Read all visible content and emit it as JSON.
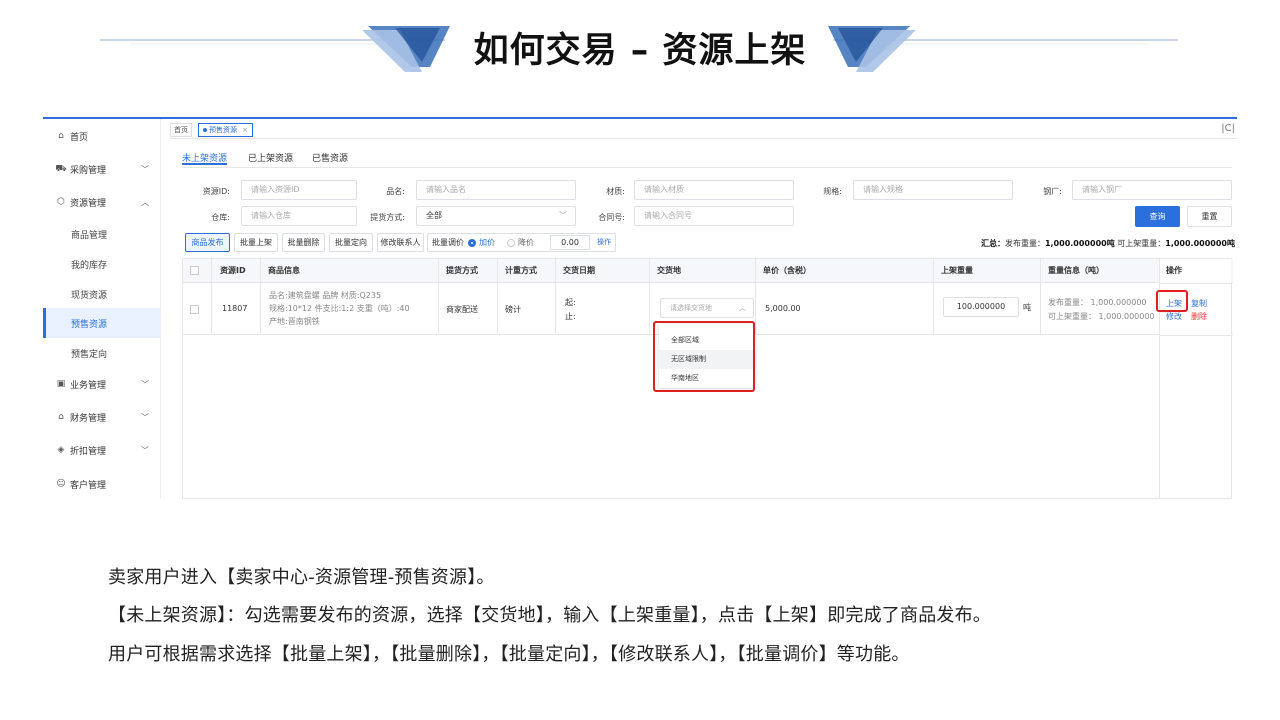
{
  "slide": {
    "title": "如何交易 – 资源上架",
    "lines": [
      "卖家用户进入【卖家中心-资源管理-预售资源】。",
      "【未上架资源】：勾选需要发布的资源，选择【交货地】，输入【上架重量】，点击【上架】即完成了商品发布。",
      "用户可根据需求选择【批量上架】，【批量删除】，【批量定向】，【修改联系人】，【批量调价】等功能。"
    ]
  },
  "colors": {
    "accent": "#2a6fdb",
    "highlight_box": "#e02020",
    "delete_link": "#e33333"
  },
  "sidebar": {
    "items": [
      {
        "label": "首页",
        "icon": "home-icon",
        "chevron": ""
      },
      {
        "label": "采购管理",
        "icon": "truck-icon",
        "chevron": "﹀"
      },
      {
        "label": "资源管理",
        "icon": "cube-icon",
        "chevron": "︿"
      },
      {
        "label": "商品管理",
        "icon": "",
        "chevron": ""
      },
      {
        "label": "我的库存",
        "icon": "",
        "chevron": ""
      },
      {
        "label": "现货资源",
        "icon": "",
        "chevron": ""
      },
      {
        "label": "预售资源",
        "icon": "",
        "chevron": ""
      },
      {
        "label": "预售定向",
        "icon": "",
        "chevron": ""
      },
      {
        "label": "业务管理",
        "icon": "briefcase-icon",
        "chevron": "﹀"
      },
      {
        "label": "财务管理",
        "icon": "lock-icon",
        "chevron": "﹀"
      },
      {
        "label": "折扣管理",
        "icon": "tag-icon",
        "chevron": "﹀"
      },
      {
        "label": "客户管理",
        "icon": "users-icon",
        "chevron": ""
      }
    ],
    "active": "预售资源"
  },
  "topbar": {
    "home_tab": "首页",
    "current_tab": "预售资源",
    "close_glyph": "×",
    "refresh_glyph": "C"
  },
  "subtabs": [
    "未上架资源",
    "已上架资源",
    "已售资源"
  ],
  "filters": {
    "resource_id": {
      "label": "资源ID:",
      "placeholder": "请输入资源ID"
    },
    "product_name": {
      "label": "品名:",
      "placeholder": "请输入品名"
    },
    "material": {
      "label": "材质:",
      "placeholder": "请输入材质"
    },
    "spec": {
      "label": "规格:",
      "placeholder": "请输入规格"
    },
    "mill": {
      "label": "钢厂:",
      "placeholder": "请输入钢厂"
    },
    "warehouse": {
      "label": "仓库:",
      "placeholder": "请输入仓库"
    },
    "delivery_method": {
      "label": "提货方式:",
      "value": "全部"
    },
    "contract_no": {
      "label": "合同号:",
      "placeholder": "请输入合同号"
    },
    "query_button": "查询",
    "reset_button": "重置"
  },
  "toolbar": {
    "buttons": [
      "商品发布",
      "批量上架",
      "批量删除",
      "批量定向",
      "修改联系人"
    ],
    "price_adjust": {
      "label": "批量调价",
      "raise": "加价",
      "lower": "降价",
      "value": "0.00",
      "action": "操作"
    },
    "summary": {
      "prefix": "汇总：",
      "publish_label": "发布重量：",
      "publish_value": "1,000.000000吨",
      "listed_label": "可上架重量：",
      "listed_value": "1,000.000000吨"
    }
  },
  "table": {
    "headers": [
      "资源ID",
      "商品信息",
      "提货方式",
      "计重方式",
      "交货日期",
      "交货地",
      "单价（含税）",
      "上架重量",
      "重量信息（吨）",
      "操作"
    ],
    "row": {
      "id": "11807",
      "info_line1": "品名:建筑盘螺   品牌   材质:Q235",
      "info_line2": "规格:10*12   件支比:1:2   支重（吨）:40",
      "info_line3": "产地:晋南钢铁",
      "delivery_method": "商家配送",
      "weighing": "磅计",
      "date_start": "起:",
      "date_end": "止:",
      "place_placeholder": "请选择交货地",
      "unit_price": "5,000.00",
      "list_weight": "100.000000",
      "weight_unit": "吨",
      "publish_weight": "发布重量：  1,000.000000",
      "listable_weight": "可上架重量：  1,000.000000",
      "ops": {
        "list": "上架",
        "copy": "复制",
        "edit": "修改",
        "delete": "删除"
      }
    }
  },
  "dropdown_options": [
    "全部区域",
    "无区域限制",
    "华南地区"
  ]
}
